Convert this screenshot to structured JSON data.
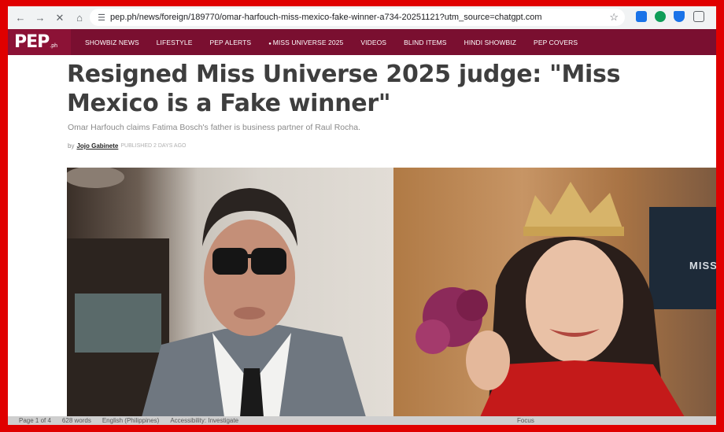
{
  "browser": {
    "url": "pep.ph/news/foreign/189770/omar-harfouch-miss-mexico-fake-winner-a734-20251121?utm_source=chatgpt.com",
    "icons": [
      "back-icon",
      "forward-icon",
      "stop-icon",
      "home-icon",
      "site-settings-icon",
      "star-icon"
    ]
  },
  "site": {
    "logo": "PEP",
    "logo_suffix": ".ph",
    "nav": [
      "SHOWBIZ NEWS",
      "LIFESTYLE",
      "PEP ALERTS",
      "MISS UNIVERSE 2025",
      "VIDEOS",
      "BLIND ITEMS",
      "HINDI SHOWBIZ",
      "PEP COVERS"
    ]
  },
  "article": {
    "headline": "Resigned Miss Universe 2025 judge: \"Miss Mexico is a Fake winner\"",
    "subheadline": "Omar Harfouch claims Fatima Bosch's father is business partner of Raul Rocha.",
    "by": "by",
    "author": "Jojo Gabinete",
    "published": "PUBLISHED 2 DAYS AGO",
    "hero_text": "MISS"
  },
  "statusbar": {
    "page": "Page 1 of 4",
    "words": "628 words",
    "language": "English (Philippines)",
    "accessibility": "Accessibility: Investigate",
    "focus": "Focus"
  },
  "colors": {
    "frame_border": "#e00000",
    "nav_bg": "#7a0f30",
    "logo_bg": "#8c1236",
    "headline": "#3e3e3e"
  }
}
